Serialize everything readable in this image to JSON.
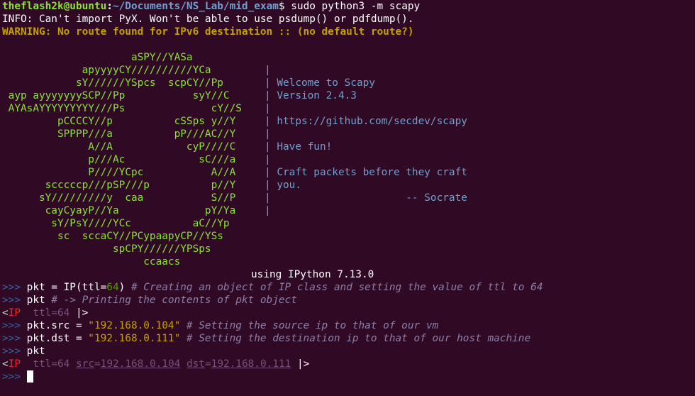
{
  "shell": {
    "user_host": "theflash2k@ubuntu",
    "sep": ":",
    "cwd": "~/Documents/NS_Lab/mid_exam",
    "dollar": "$",
    "command": " sudo python3 -m scapy"
  },
  "messages": {
    "info": "INFO: Can't import PyX. Won't be able to use psdump() or pdfdump().",
    "warning": "WARNING: No route found for IPv6 destination :: (no default route?)"
  },
  "banner": {
    "art": [
      "                     aSPY//YASa",
      "             apyyyyCY//////////YCa       ",
      "            sY//////YSpcs  scpCY//Pp     ",
      " ayp ayyyyyyySCP//Pp           syY//C    ",
      " AYAsAYYYYYYYYY///Ps              cY//S  ",
      "         pCCCCY//p          cSSps y//Y   ",
      "         SPPPP///a          pP///AC//Y   ",
      "              A//A            cyP////C   ",
      "              p///Ac            sC///a   ",
      "              P////YCpc           A//A   ",
      "       scccccp///pSP///p          p//Y   ",
      "      sY/////////y  caa           S//P   ",
      "       cayCyayP//Ya              pY/Ya   ",
      "        sY/PsY////YCc          aC//Yp    ",
      "         sc  sccaCY//PCypaapyCP//YSs     ",
      "                  spCPY//////YPSps       ",
      "                       ccaacs            "
    ],
    "side": [
      "",
      "|",
      "| Welcome to Scapy",
      "| Version 2.4.3",
      "|",
      "| https://github.com/secdev/scapy",
      "|",
      "| Have fun!",
      "|",
      "| Craft packets before they craft",
      "| you.",
      "|                      -- Socrate",
      "|",
      "",
      "",
      "",
      ""
    ],
    "ipython": "using IPython 7.13.0"
  },
  "session": {
    "prompt": ">>> ",
    "l1_code_a": "pkt = IP(ttl=",
    "l1_num": "64",
    "l1_code_b": ") ",
    "l1_comment": "# Creating an object of IP class and setting the value of ttl to 64",
    "l2_code": "pkt ",
    "l2_comment": "# -> Printing the contents of pkt object",
    "o1_open": "<",
    "o1_ip": "IP",
    "o1_ttl": "  ttl",
    "o1_eq": "=",
    "o1_val": "64",
    "o1_close": " |>",
    "l3_code": "pkt.src = ",
    "l3_str": "\"192.168.0.104\"",
    "l3_comment": " # Setting the source ip to that of our vm",
    "l4_code": "pkt.dst = ",
    "l4_str": "\"192.168.0.111\"",
    "l4_comment": " # Setting the destination ip to that of our host machine",
    "l5_code": "pkt",
    "o2_open": "<",
    "o2_ip": "IP",
    "o2_ttl": "  ttl",
    "o2_eq": "=",
    "o2_ttlval": "64",
    "o2_src": "src",
    "o2_srcval": "192.168.0.104",
    "o2_dst": "dst",
    "o2_dstval": "192.168.0.111",
    "o2_close": " |>"
  }
}
